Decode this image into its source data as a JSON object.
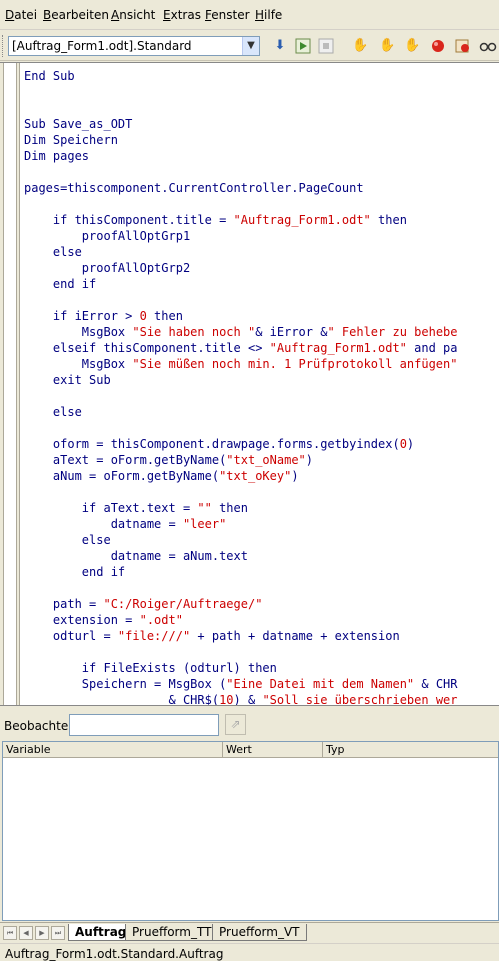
{
  "menu": {
    "items": [
      {
        "label": "Datei"
      },
      {
        "label": "Bearbeiten"
      },
      {
        "label": "Ansicht"
      },
      {
        "label": "Extras"
      },
      {
        "label": "Fenster"
      },
      {
        "label": "Hilfe"
      }
    ]
  },
  "toolbar": {
    "library_value": "[Auftrag_Form1.odt].Standard",
    "icons": [
      "compile-icon",
      "run-icon",
      "stop-icon",
      "step-into-icon",
      "step-over-icon",
      "step-out-icon",
      "breakpoint-icon",
      "manage-breakpoints-icon",
      "watch-icon"
    ]
  },
  "editor": {
    "lines": [
      "End Sub",
      "",
      "",
      "Sub Save_as_ODT",
      "Dim Speichern",
      "Dim pages",
      "",
      "pages=thiscomponent.CurrentController.PageCount",
      "",
      "    if thisComponent.title = \"Auftrag_Form1.odt\" then",
      "        proofAllOptGrp1",
      "    else",
      "        proofAllOptGrp2",
      "    end if",
      "",
      "    if iError > 0 then",
      "        MsgBox \"Sie haben noch \"& iError &\" Fehler zu behebe",
      "    elseif thisComponent.title <> \"Auftrag_Form1.odt\" and pa",
      "        MsgBox \"Sie müßen noch min. 1 Prüfprotokoll anfügen\"",
      "    exit Sub",
      "",
      "    else",
      "",
      "    oform = thisComponent.drawpage.forms.getbyindex(0)",
      "    aText = oForm.getByName(\"txt_oName\")",
      "    aNum = oForm.getByName(\"txt_oKey\")",
      "",
      "        if aText.text = \"\" then",
      "            datname = \"leer\"",
      "        else",
      "            datname = aNum.text",
      "        end if",
      "",
      "    path = \"C:/Roiger/Auftraege/\"",
      "    extension = \".odt\"",
      "    odturl = \"file:///\" + path + datname + extension",
      "",
      "        if FileExists (odturl) then",
      "        Speichern = MsgBox (\"Eine Datei mit dem Namen\" & CHR",
      "                    & CHR$(10) & \"Soll sie überschrieben wer"
    ]
  },
  "watch": {
    "label": "Beobachter:",
    "input_value": "",
    "columns": [
      "Variable",
      "Wert",
      "Typ"
    ]
  },
  "tabs": {
    "items": [
      {
        "label": "Auftrag",
        "active": true
      },
      {
        "label": "Pruefform_TT",
        "active": false
      },
      {
        "label": "Pruefform_VT",
        "active": false
      }
    ]
  },
  "status": {
    "text": "Auftrag_Form1.odt.Standard.Auftrag"
  },
  "colors": {
    "keyword": "#000080",
    "string": "#cc0000",
    "number": "#cc0000"
  }
}
